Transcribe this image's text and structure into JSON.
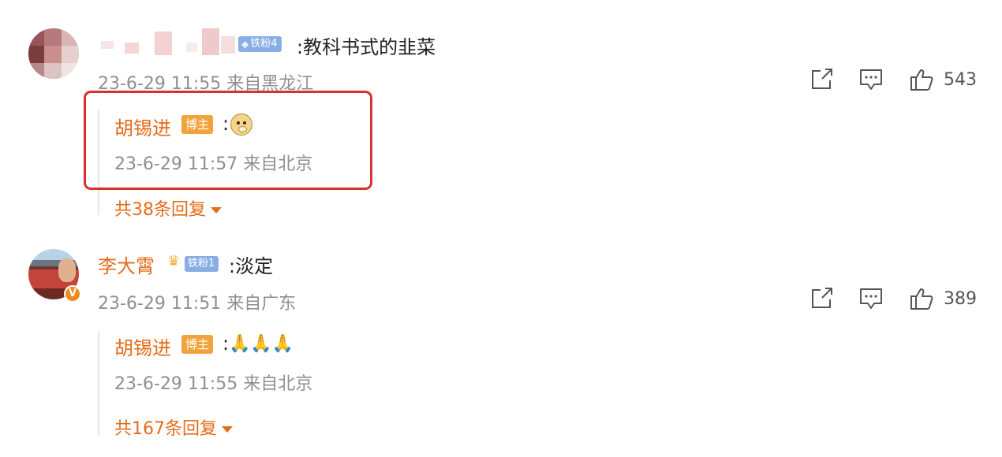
{
  "comments": [
    {
      "username": "",
      "fan_badge": "铁粉4",
      "text": ":教科书式的韭菜",
      "time": "23-6-29 11:55 来自黑龙江",
      "likes": "543",
      "reply": {
        "username": "胡锡进",
        "badge": "博主",
        "text": ":",
        "emoji": "doge-emoji",
        "time": "23-6-29 11:57 来自北京",
        "highlighted": true
      },
      "more_replies": "共38条回复"
    },
    {
      "username": "李大霄",
      "fan_badge": "铁粉1",
      "verified_badge": "V",
      "text": ":淡定",
      "time": "23-6-29 11:51 来自广东",
      "likes": "389",
      "reply": {
        "username": "胡锡进",
        "badge": "博主",
        "text": ":",
        "emoji_text": "🙏🙏🙏",
        "time": "23-6-29 11:55 来自北京"
      },
      "more_replies": "共167条回复"
    }
  ],
  "colors": {
    "username": "#e46c1b",
    "highlight_border": "#d7322b",
    "fan_badge": "#89aee6",
    "owner_badge": "#f1a33c"
  },
  "icons": [
    "share-icon",
    "comment-icon",
    "like-icon",
    "caret-down-icon"
  ]
}
